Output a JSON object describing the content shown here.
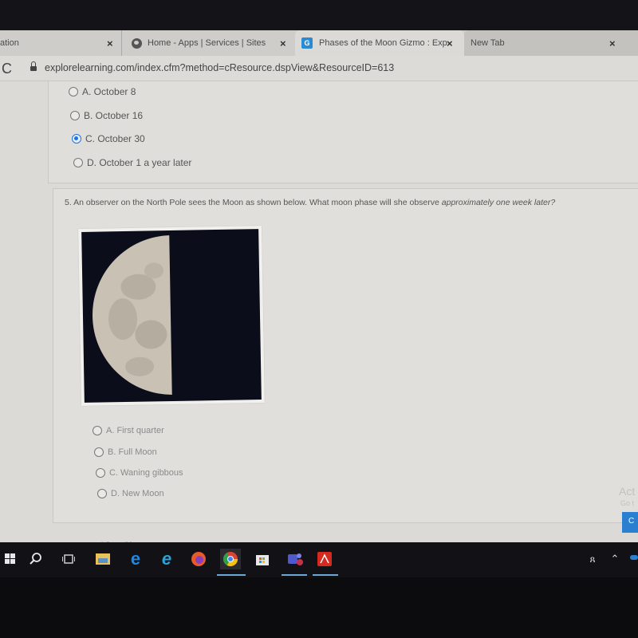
{
  "browser": {
    "tabs": [
      {
        "title": "ation",
        "close": "×"
      },
      {
        "title": "Home - Apps | Services | Sites",
        "close": "×",
        "icon": "globe-icon"
      },
      {
        "title": "Phases of the Moon Gizmo : Exp",
        "close": "×",
        "icon": "gizmo-icon",
        "icon_letter": "G",
        "active": true
      },
      {
        "title": "New Tab",
        "close": "×"
      }
    ],
    "reload_glyph": "C",
    "url": "explorelearning.com/index.cfm?method=cResource.dspView&ResourceID=613"
  },
  "question4": {
    "options": [
      {
        "label": "A. October 8",
        "selected": false
      },
      {
        "label": "B. October 16",
        "selected": false
      },
      {
        "label": "C. October 30",
        "selected": true
      },
      {
        "label": "D. October 1 a year later",
        "selected": false
      }
    ]
  },
  "question5": {
    "text_plain": "5. An observer on the North Pole sees the Moon as shown below. What moon phase will she observe ",
    "text_emphasis": "approximately one week later?",
    "image": {
      "description": "Moon with left half illuminated (third quarter)",
      "illuminated_side": "left"
    },
    "options": [
      {
        "label": "A. First quarter",
        "selected": false
      },
      {
        "label": "B. Full Moon",
        "selected": false
      },
      {
        "label": "C. Waning gibbous",
        "selected": false
      },
      {
        "label": "D. New Moon",
        "selected": false
      }
    ]
  },
  "footer": {
    "view_gizmo": "View Gizmo",
    "activate_text": "Act",
    "activate_sub": "Go t",
    "blue_button": "C"
  },
  "colors": {
    "radio_selected": "#1a73e8",
    "gizmo_icon": "#2b8bd0"
  },
  "taskbar": {
    "items": [
      {
        "name": "windows-start-icon"
      },
      {
        "name": "search-icon"
      },
      {
        "name": "task-view-icon"
      },
      {
        "name": "file-explorer-icon"
      },
      {
        "name": "edge-icon"
      },
      {
        "name": "internet-explorer-icon"
      },
      {
        "name": "firefox-icon"
      },
      {
        "name": "chrome-icon",
        "active": true
      },
      {
        "name": "store-icon"
      },
      {
        "name": "teams-icon",
        "running": true
      },
      {
        "name": "acrobat-icon",
        "running": true
      }
    ],
    "tray": [
      "people-icon",
      "chevron-up-icon"
    ]
  }
}
